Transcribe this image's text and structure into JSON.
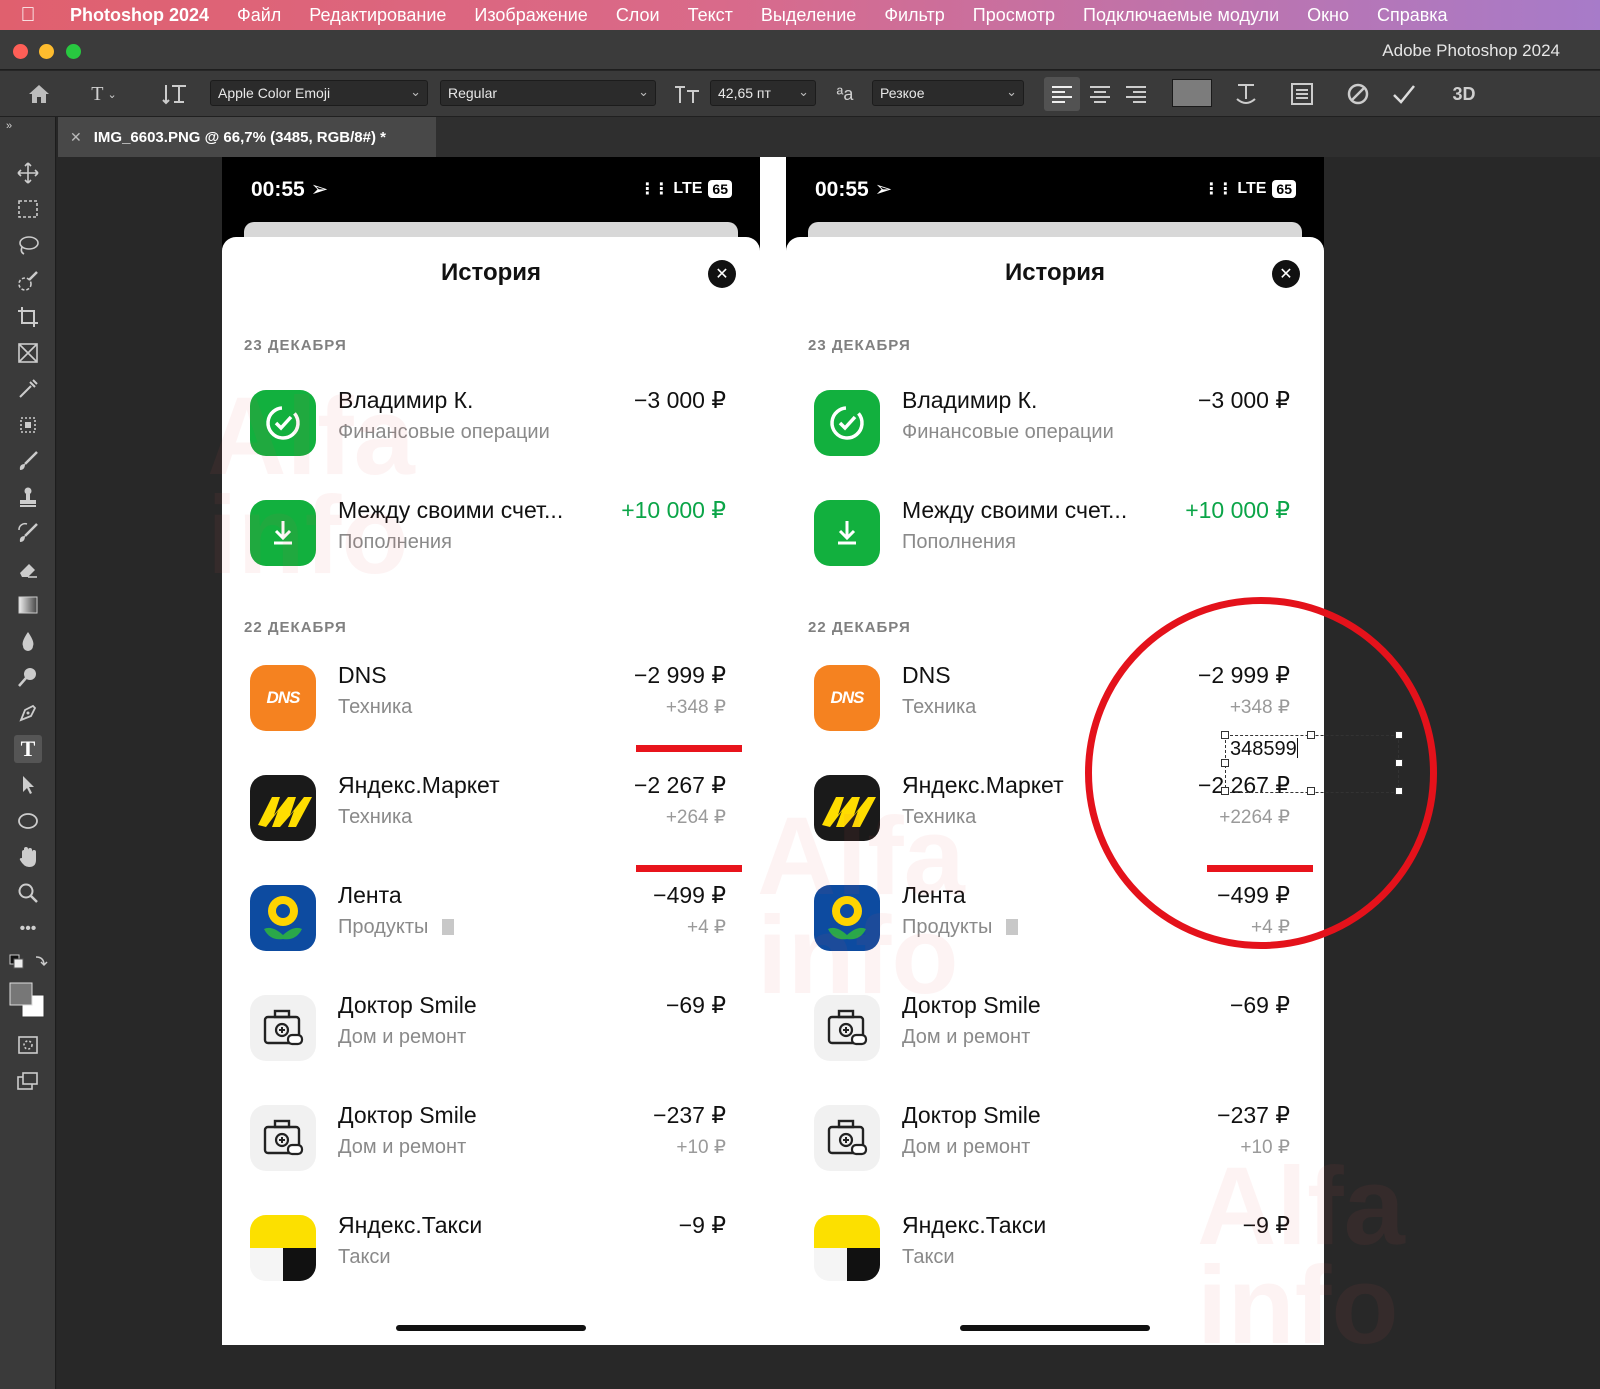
{
  "menubar": {
    "items": [
      "Photoshop 2024",
      "Файл",
      "Редактирование",
      "Изображение",
      "Слои",
      "Текст",
      "Выделение",
      "Фильтр",
      "Просмотр",
      "Подключаемые модули",
      "Окно",
      "Справка"
    ]
  },
  "window": {
    "title": "Adobe Photoshop 2024"
  },
  "options": {
    "font_family": "Apple Color Emoji",
    "font_style": "Regular",
    "font_size": "42,65 пт",
    "antialias_label": "ªa",
    "antialias": "Резкое",
    "threed": "3D"
  },
  "document": {
    "tab_title": "IMG_6603.PNG @ 66,7% (3485, RGB/8#) *"
  },
  "phones": [
    {
      "time": "00:55",
      "network": "LTE",
      "battery": "65",
      "title": "История",
      "sections": [
        "23 ДЕКАБРЯ",
        "22 ДЕКАБРЯ"
      ],
      "rows": [
        {
          "name": "Владимир К.",
          "category": "Финансовые операции",
          "amount": "−3 000 ₽",
          "cashback": ""
        },
        {
          "name": "Между своими счет...",
          "category": "Пополнения",
          "amount": "+10 000 ₽",
          "cashback": ""
        },
        {
          "name": "DNS",
          "category": "Техника",
          "amount": "−2 999 ₽",
          "cashback": "+348 ₽"
        },
        {
          "name": "Яндекс.Маркет",
          "category": "Техника",
          "amount": "−2 267 ₽",
          "cashback": "+264 ₽"
        },
        {
          "name": "Лента",
          "category": "Продукты",
          "amount": "−499 ₽",
          "cashback": "+4 ₽"
        },
        {
          "name": "Доктор Smile",
          "category": "Дом и ремонт",
          "amount": "−69 ₽",
          "cashback": ""
        },
        {
          "name": "Доктор Smile",
          "category": "Дом и ремонт",
          "amount": "−237 ₽",
          "cashback": "+10 ₽"
        },
        {
          "name": "Яндекс.Такси",
          "category": "Такси",
          "amount": "−9 ₽",
          "cashback": ""
        }
      ]
    },
    {
      "time": "00:55",
      "network": "LTE",
      "battery": "65",
      "title": "История",
      "sections": [
        "23 ДЕКАБРЯ",
        "22 ДЕКАБРЯ"
      ],
      "rows": [
        {
          "name": "Владимир К.",
          "category": "Финансовые операции",
          "amount": "−3 000 ₽",
          "cashback": ""
        },
        {
          "name": "Между своими счет...",
          "category": "Пополнения",
          "amount": "+10 000 ₽",
          "cashback": ""
        },
        {
          "name": "DNS",
          "category": "Техника",
          "amount": "−2 999 ₽",
          "cashback": "+348 ₽"
        },
        {
          "name": "Яндекс.Маркет",
          "category": "Техника",
          "amount": "−2 267 ₽",
          "cashback": "+2264 ₽"
        },
        {
          "name": "Лента",
          "category": "Продукты",
          "amount": "−499 ₽",
          "cashback": "+4 ₽"
        },
        {
          "name": "Доктор Smile",
          "category": "Дом и ремонт",
          "amount": "−69 ₽",
          "cashback": ""
        },
        {
          "name": "Доктор Smile",
          "category": "Дом и ремонт",
          "amount": "−237 ₽",
          "cashback": "+10 ₽"
        },
        {
          "name": "Яндекс.Такси",
          "category": "Такси",
          "amount": "−9 ₽",
          "cashback": ""
        }
      ],
      "edit_text": "348599"
    }
  ],
  "icons": {
    "vladimir": "check-circle-icon",
    "between": "download-arrow-icon",
    "dns": "dns-logo-icon",
    "yandex_market": "yandex-market-logo-icon",
    "lenta": "lenta-sunflower-icon",
    "doctor": "dental-kit-icon",
    "taxi": "yandex-taxi-logo-icon"
  },
  "colors": {
    "positive": "#0ba548",
    "highlight": "#e4121b",
    "menubar_start": "#e0606e",
    "menubar_end": "#a77bc9"
  },
  "dns_logo_text": "DNS",
  "watermark": {
    "line1": "Alfa",
    "line2": "info"
  }
}
